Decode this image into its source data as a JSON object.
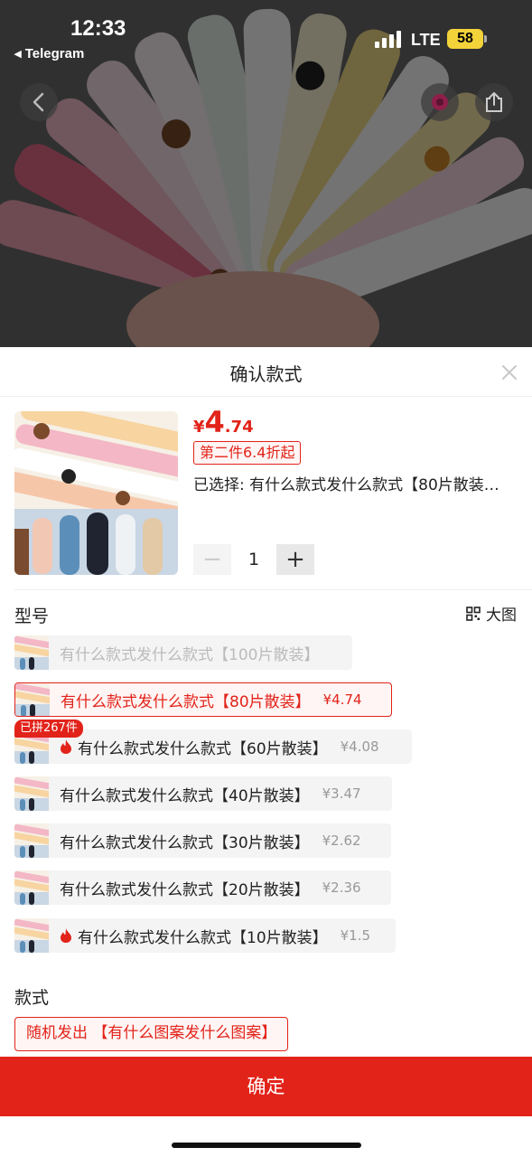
{
  "status_bar": {
    "time": "12:33",
    "back_app": "◂ Telegram",
    "network": "LTE",
    "battery": "58"
  },
  "photo": {
    "back_icon": "chevron-left-icon",
    "share_icon": "share-icon"
  },
  "sheet": {
    "title": "确认款式",
    "close_icon": "close-icon"
  },
  "product": {
    "price_currency": "¥",
    "price_int": "4",
    "price_dec": ".74",
    "promo": "第二件6.4折起",
    "selected": "已选择: 有什么款式发什么款式【80片散装…",
    "quantity": "1",
    "minus": "−",
    "plus": "+"
  },
  "model": {
    "label": "型号",
    "big_image": "大图",
    "group_badge": "已拼267件",
    "options": [
      {
        "text": "有什么款式发什么款式【100片散装】",
        "price": "",
        "state": "disabled",
        "hot": false
      },
      {
        "text": "有什么款式发什么款式【80片散装】",
        "price": "¥4.74",
        "state": "selected",
        "hot": false
      },
      {
        "text": "有什么款式发什么款式【60片散装】",
        "price": "¥4.08",
        "state": "normal",
        "hot": true
      },
      {
        "text": "有什么款式发什么款式【40片散装】",
        "price": "¥3.47",
        "state": "normal",
        "hot": false
      },
      {
        "text": "有什么款式发什么款式【30片散装】",
        "price": "¥2.62",
        "state": "normal",
        "hot": false
      },
      {
        "text": "有什么款式发什么款式【20片散装】",
        "price": "¥2.36",
        "state": "normal",
        "hot": false
      },
      {
        "text": "有什么款式发什么款式【10片散装】",
        "price": "¥1.5",
        "state": "normal",
        "hot": true
      }
    ]
  },
  "style": {
    "label": "款式",
    "option": "随机发出 【有什么图案发什么图案】"
  },
  "confirm_label": "确定",
  "colors": {
    "accent": "#e2231a",
    "option_bg": "#f4f4f4"
  }
}
